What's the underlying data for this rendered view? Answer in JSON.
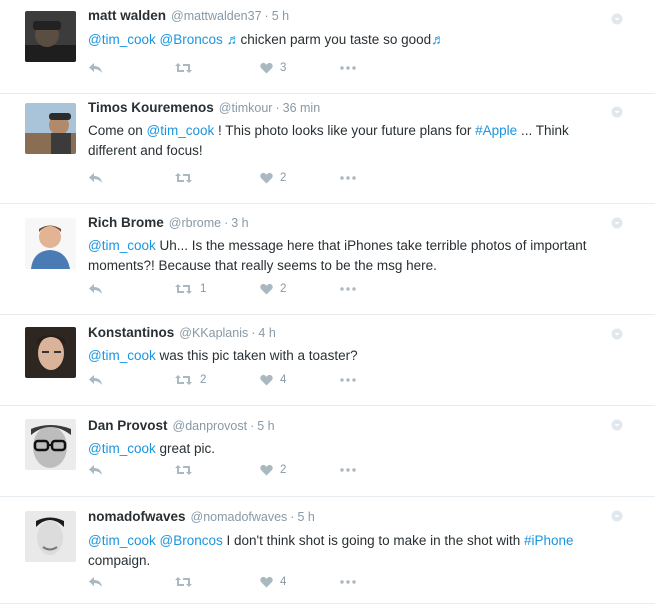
{
  "colors": {
    "link": "#1b95e0",
    "muted": "#8899a6",
    "icon": "#aab8c2"
  },
  "tweets": [
    {
      "name": "matt walden",
      "handle": "@mattwalden37",
      "time": "5 h",
      "segments": [
        {
          "t": "@tim_cook",
          "type": "link"
        },
        {
          "t": " ",
          "type": "text"
        },
        {
          "t": "@Broncos",
          "type": "link"
        },
        {
          "t": " ",
          "type": "text"
        },
        {
          "t": "♬",
          "type": "note"
        },
        {
          "t": "chicken parm you taste so good",
          "type": "text"
        },
        {
          "t": "♬",
          "type": "note"
        }
      ],
      "retweets": "",
      "likes": "3",
      "icons": {
        "reply": "reply-icon",
        "retweet": "retweet-icon",
        "like": "heart-icon",
        "more": "more-icon",
        "caret": "caret-down-icon"
      }
    },
    {
      "name": "Timos Kouremenos",
      "handle": "@timkour",
      "time": "36 min",
      "segments": [
        {
          "t": "Come on ",
          "type": "text"
        },
        {
          "t": "@tim_cook",
          "type": "link"
        },
        {
          "t": " ! This photo looks like your future plans for ",
          "type": "text"
        },
        {
          "t": "#Apple",
          "type": "link"
        },
        {
          "t": " ... Think different and focus!",
          "type": "text"
        }
      ],
      "retweets": "",
      "likes": "2"
    },
    {
      "name": "Rich Brome",
      "handle": "@rbrome",
      "time": "3 h",
      "segments": [
        {
          "t": "@tim_cook",
          "type": "link"
        },
        {
          "t": " Uh... Is the message here that iPhones take terrible photos of important moments?! Because that really seems to be the msg here.",
          "type": "text"
        }
      ],
      "retweets": "1",
      "likes": "2"
    },
    {
      "name": "Konstantinos",
      "handle": "@KKaplanis",
      "time": "4 h",
      "segments": [
        {
          "t": "@tim_cook",
          "type": "link"
        },
        {
          "t": " was this pic taken with a toaster?",
          "type": "text"
        }
      ],
      "retweets": "2",
      "likes": "4"
    },
    {
      "name": "Dan Provost",
      "handle": "@danprovost",
      "time": "5 h",
      "segments": [
        {
          "t": "@tim_cook",
          "type": "link"
        },
        {
          "t": " great pic.",
          "type": "text"
        }
      ],
      "retweets": "",
      "likes": "2"
    },
    {
      "name": "nomadofwaves",
      "handle": "@nomadofwaves",
      "time": "5 h",
      "segments": [
        {
          "t": "@tim_cook",
          "type": "link"
        },
        {
          "t": " ",
          "type": "text"
        },
        {
          "t": "@Broncos",
          "type": "link"
        },
        {
          "t": " I don't think shot is going to make in the shot with ",
          "type": "text"
        },
        {
          "t": "#iPhone",
          "type": "link"
        },
        {
          "t": " compaign.",
          "type": "text"
        }
      ],
      "retweets": "",
      "likes": "4"
    }
  ]
}
